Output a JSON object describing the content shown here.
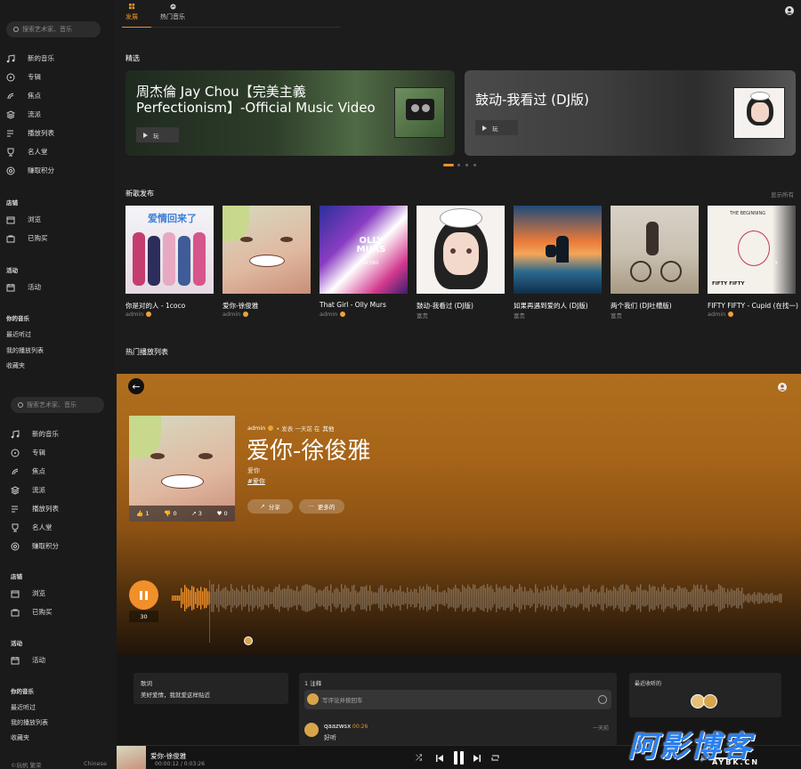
{
  "sidebar": {
    "search_placeholder": "搜索艺术家、音乐",
    "items": [
      "新的音乐",
      "专辑",
      "焦点",
      "流派",
      "播放列表",
      "名人堂",
      "赚取积分"
    ],
    "store_heading": "店铺",
    "store_items": [
      "浏览",
      "已购买"
    ],
    "activity_heading": "活动",
    "activity_items": [
      "活动"
    ],
    "your_music_heading": "你的音乐",
    "your_music_items": [
      "最近听过",
      "我的播放列表",
      "收藏夹"
    ]
  },
  "tabs": [
    "发展",
    "热门音乐"
  ],
  "featured": {
    "heading": "精选",
    "cards": [
      {
        "title": "周杰倫 Jay Chou【完美主義 Perfectionism】-Official Music Video",
        "play": "玩"
      },
      {
        "title": "鼓动-我看过 (DJ版)",
        "play": "玩"
      }
    ]
  },
  "releases": {
    "heading": "新歌发布",
    "show_all": "显示所有",
    "items": [
      {
        "title": "你是对的人 - 1coco",
        "artist": "admin",
        "verified": true
      },
      {
        "title": "爱你-徐俊雅",
        "artist": "admin",
        "verified": true
      },
      {
        "title": "That Girl - Olly Murs",
        "artist": "admin",
        "verified": true
      },
      {
        "title": "鼓动-我看过 (DJ版)",
        "artist": "富贵",
        "verified": false
      },
      {
        "title": "如果再遇到爱的人 (DJ版)",
        "artist": "富贵",
        "verified": false
      },
      {
        "title": "两个我们 (DJ吐槽版)",
        "artist": "富贵",
        "verified": false
      },
      {
        "title": "FIFTY FIFTY - Cupid (在找一)",
        "artist": "admin",
        "verified": true
      }
    ],
    "cover_texts": {
      "olly": "OLLY MURS",
      "olly_sub": "24 HRS",
      "beginning": "THE BEGINNING",
      "fifty": "FIFTY FIFTY",
      "lover": "爱情回来了"
    }
  },
  "playlists_heading": "热门播放列表",
  "song": {
    "meta_artist": "admin",
    "meta_posted": "• 发表 一天前 在",
    "meta_category": "其他",
    "title": "爱你-徐俊雅",
    "subtitle": "爱你",
    "tag": "#爱你",
    "share": "分享",
    "more": "更多的",
    "likes": "1",
    "dislikes": "0",
    "shares": "3",
    "favorites": "0",
    "play_count": "30"
  },
  "lyrics": {
    "heading": "歌词",
    "text": "美好爱情，我就爱这样贴近"
  },
  "comments": {
    "heading": "1 注释",
    "placeholder": "写评论并按回车",
    "items": [
      {
        "user": "qaazwsx",
        "time": "00:26",
        "ago": "一天前",
        "text": "好听"
      }
    ]
  },
  "recent": {
    "heading": "最近收听的"
  },
  "player": {
    "title": "爱你-徐俊雅",
    "time": "00:00:12 / 0:03:26"
  },
  "footer_partial": {
    "left": "©玩帆 繁荣",
    "right": "Chinese"
  },
  "watermark": {
    "main": "阿影博客",
    "sub": "AYBK.CN"
  },
  "colors": {
    "accent": "#f0902a",
    "bg": "#1c1c1c"
  }
}
